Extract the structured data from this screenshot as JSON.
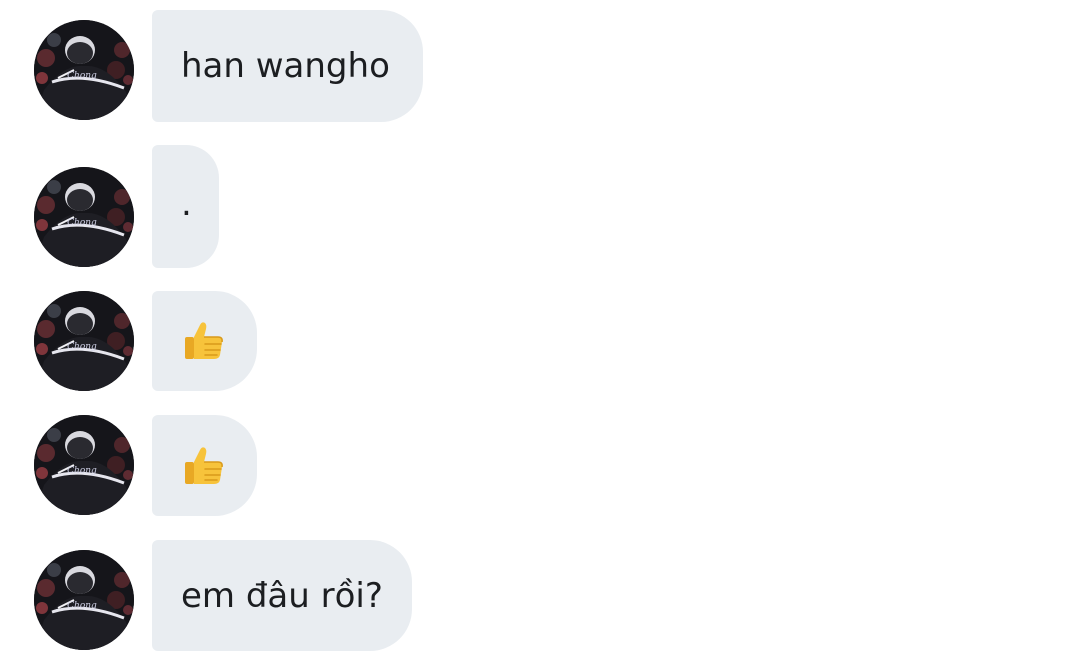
{
  "messages": [
    {
      "kind": "text",
      "text": "han wangho",
      "avatar_icon": "sender-avatar"
    },
    {
      "kind": "text",
      "text": ".",
      "avatar_icon": "sender-avatar"
    },
    {
      "kind": "emoji",
      "emoji": "thumbs-up-icon",
      "avatar_icon": "sender-avatar"
    },
    {
      "kind": "emoji",
      "emoji": "thumbs-up-icon",
      "avatar_icon": "sender-avatar"
    },
    {
      "kind": "text",
      "text": "em đâu rồi?",
      "avatar_icon": "sender-avatar"
    }
  ],
  "colors": {
    "bubble_bg": "#e9edf1",
    "text": "#1c1e21",
    "page_bg": "#ffffff"
  }
}
